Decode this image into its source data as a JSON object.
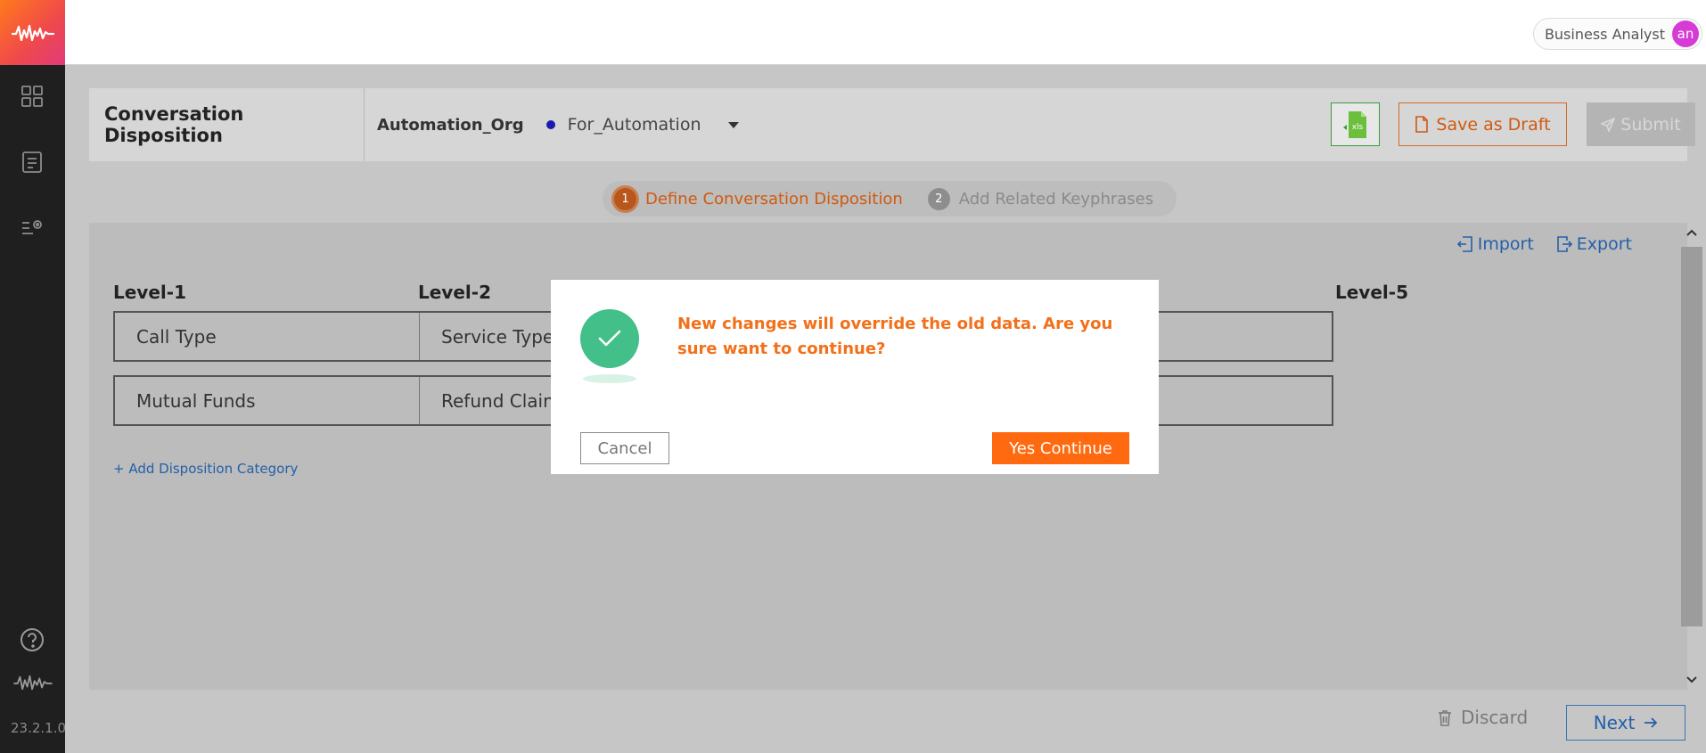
{
  "header": {
    "role": "Business Analyst",
    "avatar_initials": "an"
  },
  "sidebar": {
    "version": "23.2.1.0"
  },
  "page": {
    "title": "Conversation Disposition",
    "org": "Automation_Org",
    "project": "For_Automation",
    "save_draft_label": "Save as Draft",
    "submit_label": "Submit",
    "xls_label": "xls"
  },
  "stepper": {
    "steps": [
      {
        "num": "1",
        "label": "Define Conversation Disposition"
      },
      {
        "num": "2",
        "label": "Add Related Keyphrases"
      }
    ]
  },
  "panel": {
    "import_label": "Import",
    "export_label": "Export",
    "levels": [
      "Level-1",
      "Level-2",
      "Level-5"
    ],
    "rows": [
      {
        "c1": "Call Type",
        "c2": "Service Type"
      },
      {
        "c1": "Mutual Funds",
        "c2": "Refund Clain"
      }
    ],
    "add_category": "+ Add Disposition Category"
  },
  "footer": {
    "discard_label": "Discard",
    "next_label": "Next"
  },
  "modal": {
    "message": "New changes will override the old data. Are you sure want to continue?",
    "cancel_label": "Cancel",
    "confirm_label": "Yes Continue"
  },
  "colors": {
    "accent": "#ff6a10",
    "link": "#2560a8",
    "success": "#43c08a"
  }
}
